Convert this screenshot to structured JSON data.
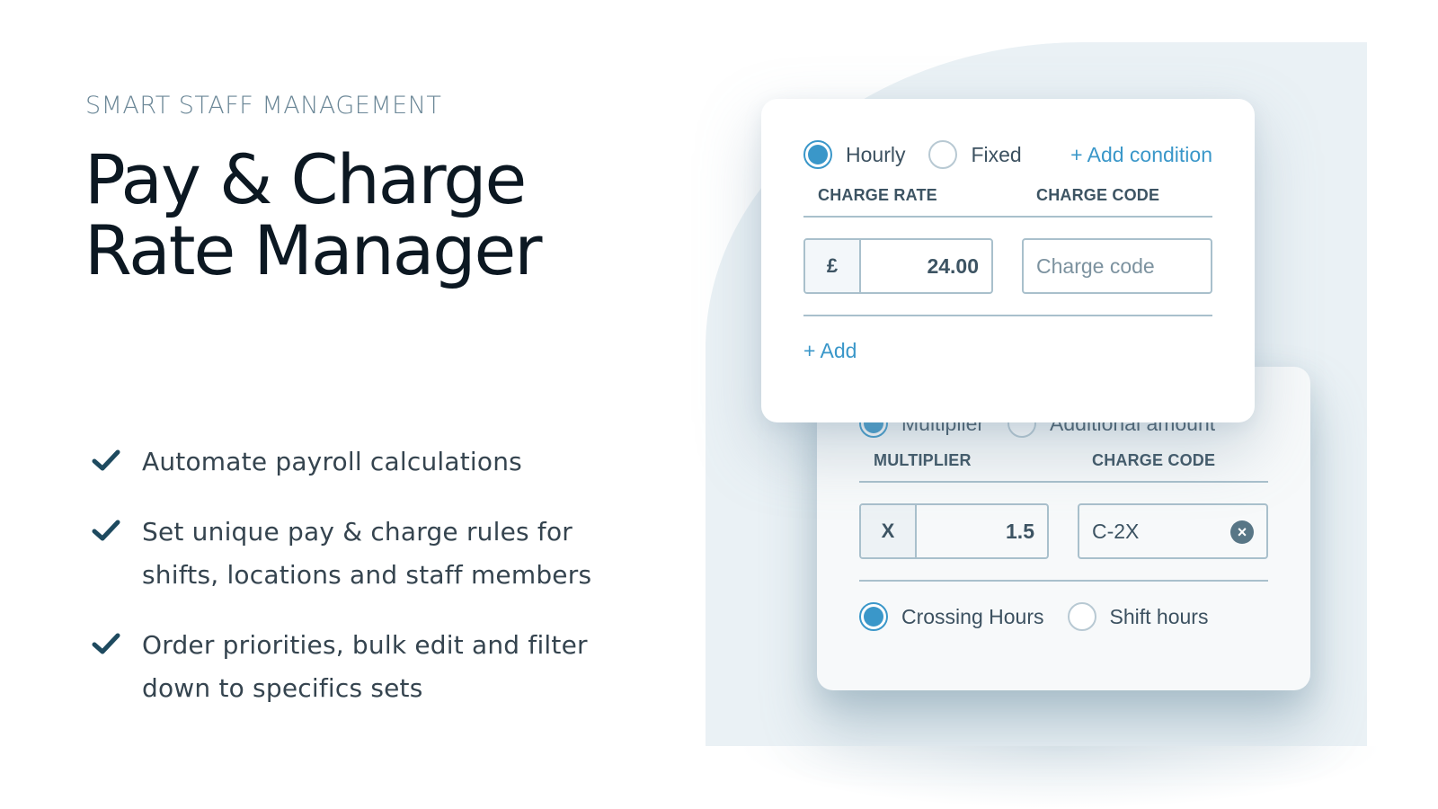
{
  "hero": {
    "eyebrow": "SMART STAFF MANAGEMENT",
    "title_line1": "Pay & Charge",
    "title_line2": "Rate Manager"
  },
  "features": [
    {
      "icon": "check-icon",
      "line1": "Automate payroll calculations",
      "line2": ""
    },
    {
      "icon": "check-icon",
      "line1": "Set unique pay & charge rules for",
      "line2": "shifts, locations and staff members"
    },
    {
      "icon": "check-icon",
      "line1": "Order priorities, bulk edit and filter",
      "line2": "down to specifics sets"
    }
  ],
  "colors": {
    "accent": "#3a97c9",
    "check": "#1e4a5f",
    "backdrop": "#eaf1f5",
    "border": "#a9c0cc",
    "clear_icon": "#587686"
  },
  "charge_card": {
    "rate_type_options": [
      {
        "label": "Hourly",
        "selected": true
      },
      {
        "label": "Fixed",
        "selected": false
      }
    ],
    "add_condition_label": "+ Add condition",
    "col_rate_header": "CHARGE RATE",
    "col_code_header": "CHARGE CODE",
    "currency_prefix": "£",
    "rate_value": "24.00",
    "code_placeholder": "Charge code",
    "code_value": "",
    "add_label": "+ Add"
  },
  "condition_card": {
    "mode_options": [
      {
        "label": "Multiplier",
        "selected": true
      },
      {
        "label": "Additional amount",
        "selected": false
      }
    ],
    "col_multiplier_header": "MULTIPLIER",
    "col_code_header": "CHARGE CODE",
    "multiplier_prefix": "X",
    "multiplier_value": "1.5",
    "code_value": "C-2X",
    "clear_icon": "×",
    "hours_options": [
      {
        "label": "Crossing Hours",
        "selected": true
      },
      {
        "label": "Shift hours",
        "selected": false
      }
    ]
  }
}
